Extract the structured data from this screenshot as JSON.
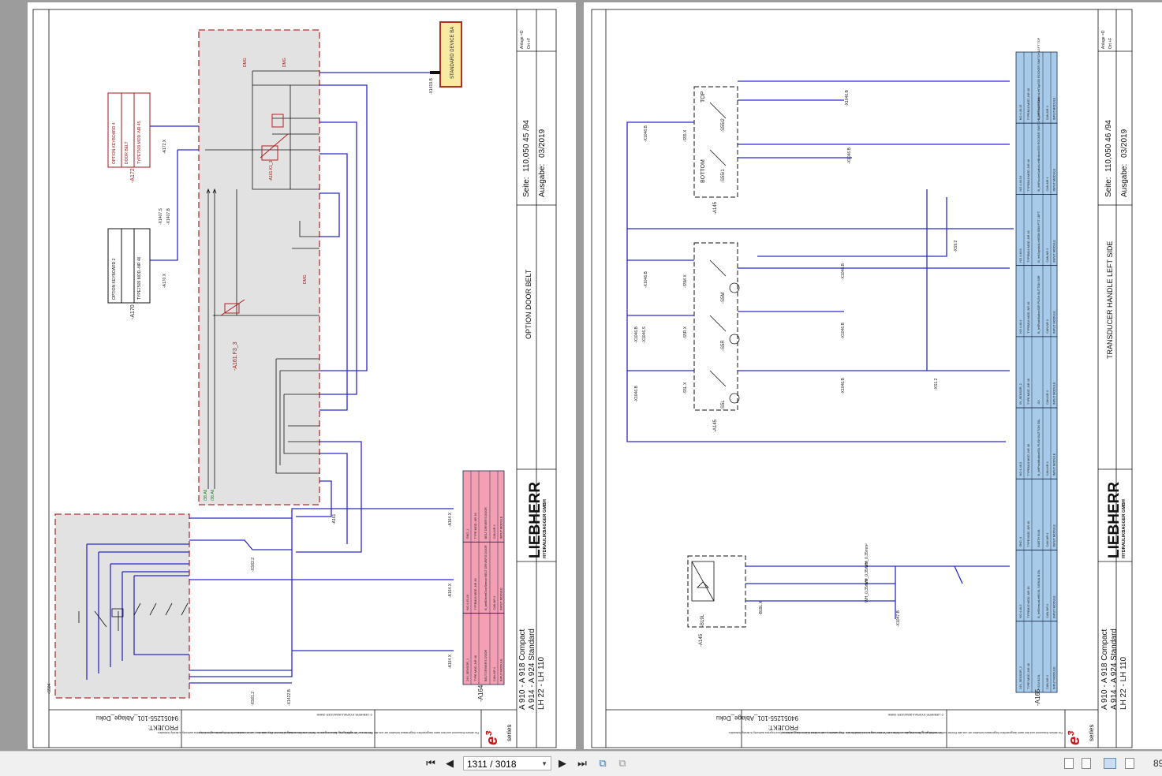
{
  "left_page": {
    "title": "OPTION DOOR BELT",
    "seite_label": "Seite:",
    "seite_value": "110,050 45 /94",
    "ausgabe_label": "Ausgabe:",
    "ausgabe_value": "03/2019",
    "anlage": "Anlage =D",
    "ort": "Ort +F",
    "models": [
      "A 910 - A 918 Compact",
      "A 914 - A 924 Standard",
      "LH 22 - LH 110"
    ],
    "logo_brand": "LIEBHERR",
    "logo_sub": "HYDRAULIKBAGGER GMBH",
    "series_label": "series",
    "project_label": "PROJEKT:",
    "project_value": "94051255-101_Ablage_Doku",
    "notice_en": "We reserve all rights in this document and in the information contained therein. Reproduction, use or disclosure to third parties without express authority is strictly forbidden.",
    "notice_copy": "© LIEBHERR HYDRAULIKBAGGER GMBH",
    "notice_de": "Für dieses Dokument und den darin dargestellten Gegenstand behalten wir uns alle Rechte vor. Vervielfältigung, Bekanntgabe an Dritte oder Verwertung seines Inhaltes sind ohne unsere ausdrückliche Zustimmung verboten.",
    "labels": {
      "std_device": "STANDARD DEVICE BA",
      "x1419": "-X1419.B",
      "a172": "-A172",
      "a172x": "-A172.X",
      "a170": "-A170",
      "a170x": "-A170.X",
      "opt_kb1": "OPTION KEYBOARD 4",
      "opt_kb2": "DOOR BELT",
      "opt_kb3": "TYPE7509  MOD.-NR 45",
      "opt2_1": "OPTION KEYBOARD 2",
      "opt2_2": "TYPE7509  MOD.-NR 46",
      "x1407": "-X1407.S",
      "x1407b": "-X1407.B",
      "a161f3": "-A161.F3_3",
      "a161k1": "-A161.K1_3",
      "s504": "-S504",
      "xs61": "-XS61.2",
      "xs62": "-XS62.2",
      "x1422": "-X1422.B",
      "a164": "-A164",
      "a164x": "-A164.X",
      "a161": "-A161",
      "dm": "DMG",
      "c38a": "/38.A6",
      "c38b": "/38.A6"
    },
    "modules": [
      {
        "r1": "GND_1",
        "r2": "TYPE   MOD.-NR 46",
        "r3": "BELT DRIVER'S DOOR",
        "r4": "CAN-NR 4",
        "r5": "INPUT MODULE"
      },
      {
        "r1": "NO 4.45.18",
        "r2": "TYPEM16   MOD.-NR 46",
        "r3": "B_beltDriverDoorSensor BELT DRIVER'S DOOR",
        "r4": "CAN-NR 4",
        "r5": "INPUT MODULE"
      },
      {
        "r1": "24V_SENSOR_1",
        "r2": "TYPE   MOD.-NR 46",
        "r3": "BELT DRIVER'S DOOR",
        "r4": "CAN-NR 4",
        "r5": "INPUT MODULE"
      }
    ],
    "module_tag": "-A164"
  },
  "right_page": {
    "title": "TRANSDUCER HANDLE LEFT SIDE",
    "seite_label": "Seite:",
    "seite_value": "110,050 46 /94",
    "ausgabe_label": "Ausgabe:",
    "ausgabe_value": "03/2019",
    "anlage": "Anlage =D",
    "ort": "Ort +F",
    "models": [
      "A 910 - A 918 Compact",
      "A 914 - A 924 Standard",
      "LH 22 - LH 110"
    ],
    "logo_brand": "LIEBHERR",
    "logo_sub": "HYDRAULIKBAGGER GMBH",
    "series_label": "series",
    "project_label": "PROJEKT:",
    "project_value": "94051255-101_Ablage_Doku",
    "notice_en": "We reserve all rights in this document and in the information contained therein. Reproduction, use or disclosure to third parties without express authority is strictly forbidden.",
    "notice_copy": "© LIEBHERR HYDRAULIKBAGGER GMBH",
    "notice_de": "Für dieses Dokument und den darin dargestellten Gegenstand behalten wir uns alle Rechte vor. Vervielfältigung, Bekanntgabe an Dritte oder Verwertung seines Inhaltes sind ohne unsere ausdrückliche Zustimmung verboten.",
    "labels": {
      "top": "TOP",
      "bottom": "BOTTOM",
      "s55": "-S55/2",
      "s55x": "-S55.X",
      "s55l": "-S55/1",
      "s5m": "-S5M",
      "s5r": "-S5R",
      "s5l": "-S5L",
      "s5mx": "-S5M.X",
      "s5rx": "-S5R.X",
      "s5lx": "-S5L.X",
      "a145a": "-A145",
      "a145b": "-A145",
      "a145c": "-A145",
      "b19l": "-B19L",
      "b19lx": "-B19L.X",
      "x1046": "-X1046.B",
      "x1046s": "-X1046.S",
      "x1047": "-X1047.B",
      "xs9": "-XS9.2",
      "xs1": "-XS1.2",
      "a165x": "-A165.X",
      "a165": "-A165",
      "wh": "WH_0,35mm²"
    },
    "modules": [
      {
        "r1": "NO 4.46.15",
        "r2": "TYPEM16   MOD.-NR 46",
        "r3": "B_leftRockerSwitchLeftTopS55 ROCKER SWITCH LEFT TOP",
        "r4": "CAN-NR 4",
        "r5": "INPUT MODULE"
      },
      {
        "r1": "NO 4.46.16",
        "r2": "TYPEM16   MOD.-NR 46",
        "r3": "B_leftRockerSwitchLeftBottomS55 ROCKER SWITCH LEFT BOTTOM",
        "r4": "CAN-NR 4",
        "r5": "INPUT MODULE"
      },
      {
        "r1": "NO 4.46.6",
        "r2": "TYPEM16   MOD.-NR 46",
        "r3": "B_leftJoystickLeftS5M S5M PTT LEFT",
        "r4": "CAN-NR 4",
        "r5": "INPUT MODULE"
      },
      {
        "r1": "NO 4.46.4",
        "r2": "TYPEM16   MOD.-NR 46",
        "r3": "B_leftPushButtonS5R PUSH BUTTON S5R",
        "r4": "CAN-NR 4",
        "r5": "INPUT MODULE"
      },
      {
        "r1": "0V_SENSOR_2",
        "r2": "TYPE   MOD.-NR 46",
        "r3": "-0V",
        "r4": "CAN-NR 4",
        "r5": "INPUT MODULE"
      },
      {
        "r1": "NO 4.46.3",
        "r2": "TYPEM16   MOD.-NR 46",
        "r3": "B_leftPushButtonS5L PUSH BUTTON S5L",
        "r4": "CAN-NR 4",
        "r5": "INPUT MODULE"
      },
      {
        "r1": "GND_3",
        "r2": "TYPE   MOD.-NR 46",
        "r3": "EARTH B19L",
        "r4": "CAN-NR 4",
        "r5": "INPUT MODULE"
      },
      {
        "r1": "NO 4.46.2",
        "r2": "TYPEM16   MOD.-NR 46",
        "r3": "B_leftSensorLeftB19L SIGNAL B19L",
        "r4": "CAN-NR 4",
        "r5": "INPUT MODULE"
      },
      {
        "r1": "24V_SENSOR_2",
        "r2": "TYPE   MOD.-NR 46",
        "r3": "+24V B19L",
        "r4": "CAN-NR 4",
        "r5": "INPUT MODULE"
      }
    ],
    "module_tag": "-A165"
  },
  "toolbar": {
    "page_value": "1311 / 3018",
    "zoom": "89",
    "icons": [
      "first-page-icon",
      "prev-page-icon",
      "next-page-icon",
      "last-page-icon",
      "rotate-icon",
      "extract-icon",
      "single-page-icon",
      "continuous-icon",
      "two-page-icon",
      "two-page-continuous-icon"
    ],
    "accent": "#c8dcf2"
  },
  "colors": {
    "wire": "#2a2ac8",
    "pink_module": "#f4a0b4",
    "blue_module": "#a8cbea",
    "component_box": "#b02020",
    "standard_device": "#f8eaa0"
  }
}
